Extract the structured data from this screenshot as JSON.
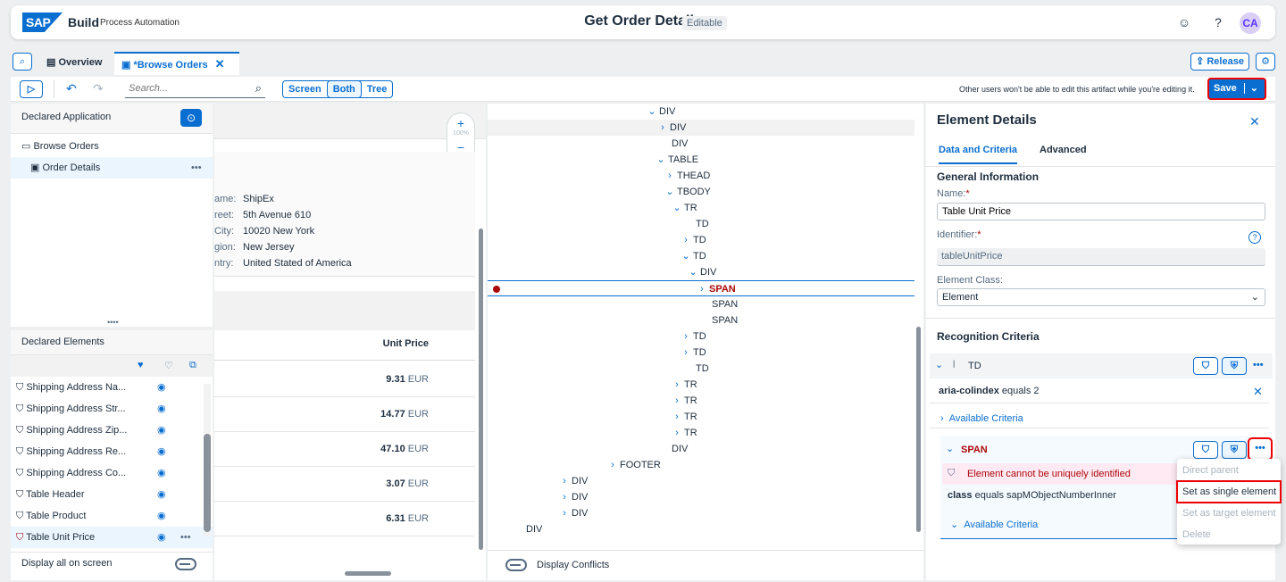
{
  "shell": {
    "logo": "SAP",
    "brand": "Build",
    "brand_sub": "Process Automation",
    "title": "Get Order Details",
    "badge": "Editable",
    "avatar": "CA"
  },
  "tabs": {
    "overview": "Overview",
    "browse": "*Browse Orders",
    "release": "Release"
  },
  "toolbar": {
    "search_placeholder": "Search...",
    "seg_screen": "Screen",
    "seg_both": "Both",
    "seg_tree": "Tree",
    "notice": "Other users won't be able to edit this artifact while you're editing it.",
    "save": "Save"
  },
  "declared": {
    "title": "Declared Application",
    "app": "Browse Orders",
    "screen": "Order Details",
    "elements_title": "Declared Elements",
    "elements": [
      "Shipping Address Na...",
      "Shipping Address Str...",
      "Shipping Address Zip...",
      "Shipping Address Re...",
      "Shipping Address Co...",
      "Table Header",
      "Table Product",
      "Table Unit Price"
    ],
    "display_all": "Display all on screen"
  },
  "preview": {
    "zoom": "100%",
    "labels": [
      "ame:",
      "reet:",
      "City:",
      "gion:",
      "ntry:"
    ],
    "values": [
      "ShipEx",
      "5th Avenue 610",
      "10020 New York",
      "New Jersey",
      "United Stated of America"
    ],
    "col_header": "Unit Price",
    "prices": [
      {
        "v": "9.31",
        "c": "EUR"
      },
      {
        "v": "14.77",
        "c": "EUR"
      },
      {
        "v": "47.10",
        "c": "EUR"
      },
      {
        "v": "3.07",
        "c": "EUR"
      },
      {
        "v": "6.31",
        "c": "EUR"
      }
    ]
  },
  "dom": {
    "nodes": [
      "DIV",
      "DIV",
      "DIV",
      "TABLE",
      "THEAD",
      "TBODY",
      "TR",
      "TD",
      "TD",
      "TD",
      "DIV",
      "SPAN",
      "SPAN",
      "SPAN",
      "TD",
      "TD",
      "TD",
      "TR",
      "TR",
      "TR",
      "TR",
      "DIV",
      "FOOTER",
      "DIV",
      "DIV",
      "DIV",
      "DIV"
    ],
    "display_conflicts": "Display Conflicts"
  },
  "details": {
    "title": "Element Details",
    "tab1": "Data and Criteria",
    "tab2": "Advanced",
    "general": "General Information",
    "name_label": "Name:",
    "name_value": "Table Unit Price",
    "id_label": "Identifier:",
    "id_value": "tableUnitPrice",
    "class_label": "Element Class:",
    "class_value": "Element",
    "recognition": "Recognition Criteria",
    "td_label": "TD",
    "crit1_attr": "aria-colindex",
    "crit1_rest": " equals 2",
    "available": "Available Criteria",
    "span_label": "SPAN",
    "error": "Element cannot be uniquely identified",
    "crit2_attr": "class",
    "crit2_rest": " equals sapMObjectNumberInner",
    "available2": "Available Criteria"
  },
  "menu": {
    "items": [
      "Direct parent",
      "Set as single element",
      "Set as target element",
      "Delete"
    ]
  },
  "colors": {
    "accent": "#0a6ed1",
    "error": "#aa0808",
    "highlight": "#e00000"
  }
}
